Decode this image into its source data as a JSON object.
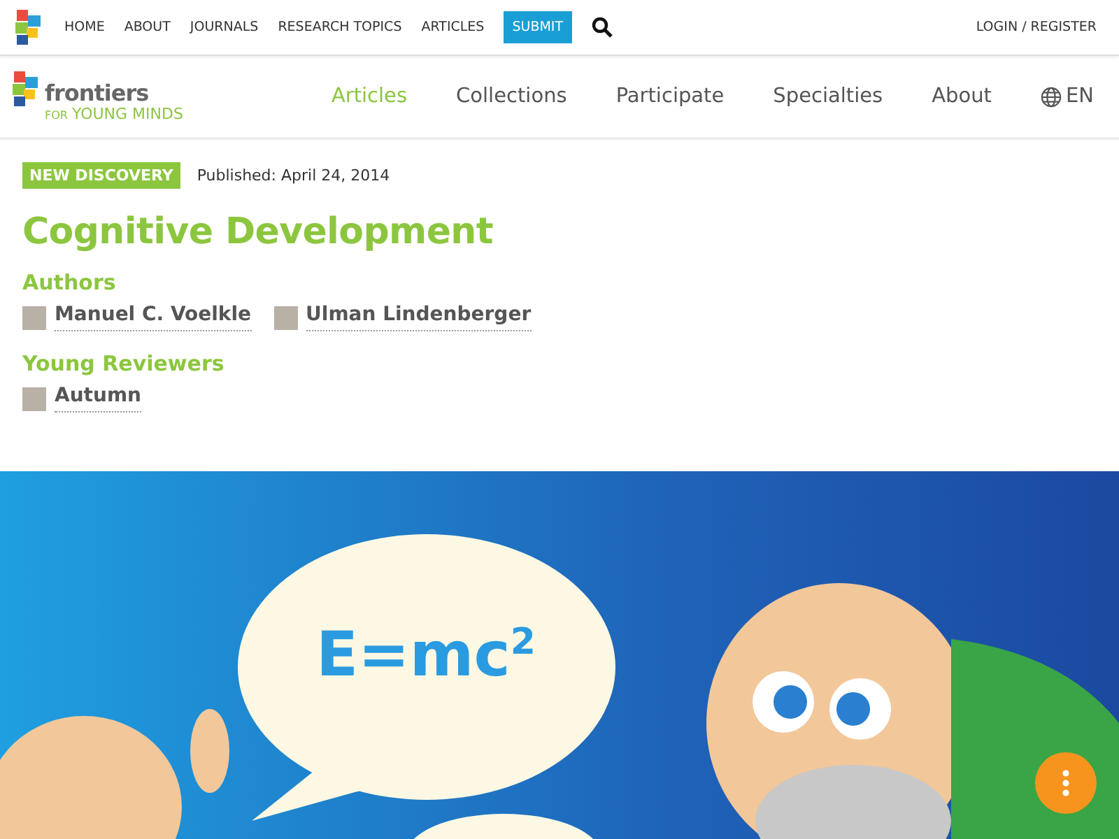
{
  "top_nav": {
    "links": [
      {
        "label": "HOME",
        "kind": "link"
      },
      {
        "label": "ABOUT",
        "kind": "link"
      },
      {
        "label": "JOURNALS",
        "kind": "link"
      },
      {
        "label": "RESEARCH TOPICS",
        "kind": "link"
      },
      {
        "label": "ARTICLES",
        "kind": "link"
      },
      {
        "label": "SUBMIT",
        "kind": "button"
      }
    ],
    "account": "LOGIN / REGISTER"
  },
  "brand": {
    "name": "frontiers",
    "tagline_prefix": "FOR",
    "tagline": "YOUNG MINDS"
  },
  "main_nav": {
    "items": [
      {
        "label": "Articles",
        "selected": true
      },
      {
        "label": "Collections",
        "selected": false
      },
      {
        "label": "Participate",
        "selected": false
      },
      {
        "label": "Specialties",
        "selected": false
      },
      {
        "label": "About",
        "selected": false
      }
    ],
    "language": "EN"
  },
  "article": {
    "badge": "NEW DISCOVERY",
    "published": "Published: April 24, 2014",
    "title": "Cognitive Development",
    "sections": [
      {
        "heading": "Authors",
        "people": [
          "Manuel C. Voelkle",
          "Ulman Lindenberger"
        ]
      },
      {
        "heading": "Young Reviewers",
        "people": [
          "Autumn"
        ]
      }
    ]
  },
  "illustration": {
    "formula": "E=mc$^{2}$"
  }
}
